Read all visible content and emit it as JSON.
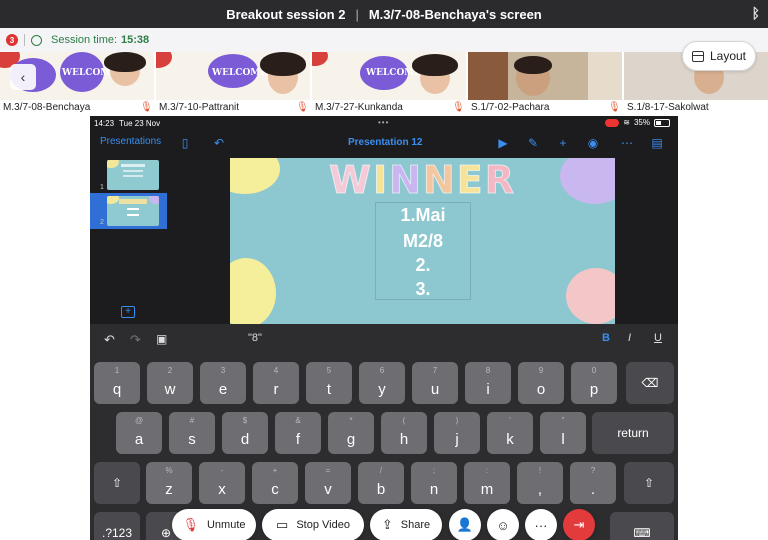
{
  "window": {
    "session_name": "Breakout session 2",
    "screen_title": "M.3/7-08-Benchaya's screen"
  },
  "session": {
    "badge_count": "3",
    "time_label": "Session time:",
    "time_value": "15:38"
  },
  "layout_button": {
    "label": "Layout"
  },
  "participants": [
    {
      "name": "M.3/7-08-Benchaya",
      "muted": true
    },
    {
      "name": "M.3/7-10-Pattranit",
      "muted": true
    },
    {
      "name": "M.3/7-27-Kunkanda",
      "muted": true
    },
    {
      "name": "S.1/7-02-Pachara",
      "muted": true
    },
    {
      "name": "S.1/8-17-Sakolwat",
      "muted": false
    }
  ],
  "tile_labels": {
    "welcome": "WELCOME"
  },
  "ipad": {
    "time": "14:23",
    "date": "Tue 23 Nov",
    "battery": "35%",
    "toolbar": {
      "presentations": "Presentations",
      "title": "Presentation 12"
    },
    "navigator": {
      "slide_numbers": [
        "1",
        "2"
      ]
    },
    "slide": {
      "heading": "WINNER",
      "letters": [
        {
          "char": "W",
          "color": "#f4c9d8"
        },
        {
          "char": "I",
          "color": "#f6e39a"
        },
        {
          "char": "N",
          "color": "#c9b5ef"
        },
        {
          "char": "N",
          "color": "#f3c6a0"
        },
        {
          "char": "E",
          "color": "#f6e39a"
        },
        {
          "char": "R",
          "color": "#f4b7c4"
        }
      ],
      "lines": [
        "1.Mai",
        "M2/8",
        "2.",
        "3."
      ]
    },
    "keyboard_bar": {
      "suggestion": "\"8\"",
      "bold": "B",
      "italic": "I",
      "underline": "U"
    },
    "keyboard": {
      "row1": [
        {
          "k": "q",
          "s": "1"
        },
        {
          "k": "w",
          "s": "2"
        },
        {
          "k": "e",
          "s": "3"
        },
        {
          "k": "r",
          "s": "4"
        },
        {
          "k": "t",
          "s": "5"
        },
        {
          "k": "y",
          "s": "6"
        },
        {
          "k": "u",
          "s": "7"
        },
        {
          "k": "i",
          "s": "8"
        },
        {
          "k": "o",
          "s": "9"
        },
        {
          "k": "p",
          "s": "0"
        }
      ],
      "row2": [
        {
          "k": "a",
          "s": "@"
        },
        {
          "k": "s",
          "s": "#"
        },
        {
          "k": "d",
          "s": "$"
        },
        {
          "k": "f",
          "s": "&"
        },
        {
          "k": "g",
          "s": "*"
        },
        {
          "k": "h",
          "s": "("
        },
        {
          "k": "j",
          "s": ")"
        },
        {
          "k": "k",
          "s": "'"
        },
        {
          "k": "l",
          "s": "\""
        }
      ],
      "row3": [
        {
          "k": "z",
          "s": "%"
        },
        {
          "k": "x",
          "s": "-"
        },
        {
          "k": "c",
          "s": "+"
        },
        {
          "k": "v",
          "s": "="
        },
        {
          "k": "b",
          "s": "/"
        },
        {
          "k": "n",
          "s": ";"
        },
        {
          "k": "m",
          "s": ":"
        },
        {
          "k": "!",
          "s": "!"
        },
        {
          "k": "?",
          "s": "?"
        }
      ],
      "return_label": "return",
      "numbers_label": ".?123"
    }
  },
  "controls": {
    "unmute": "Unmute",
    "stop_video": "Stop Video",
    "share": "Share",
    "more": "···"
  }
}
